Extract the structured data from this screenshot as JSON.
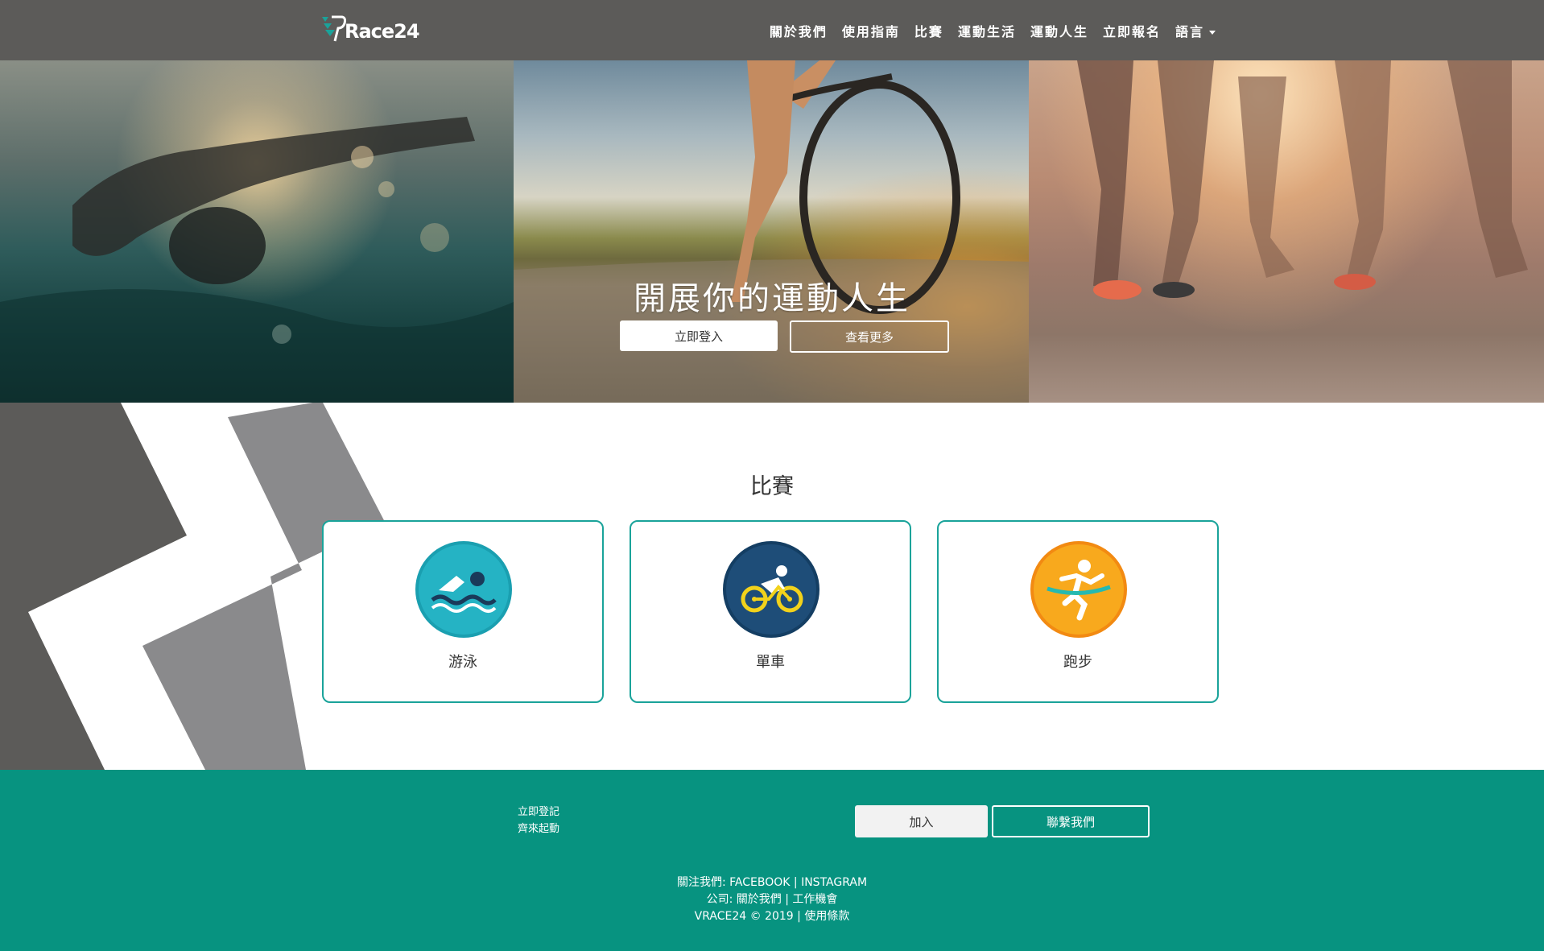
{
  "brand": {
    "logo_text": "Race24"
  },
  "nav": {
    "items": [
      "關於我們",
      "使用指南",
      "比賽",
      "運動生活",
      "運動人生",
      "立即報名"
    ],
    "language": "語言"
  },
  "hero": {
    "title": "開展你的運動人生",
    "login_button": "立即登入",
    "more_button": "查看更多"
  },
  "section": {
    "title": "比賽"
  },
  "cards": [
    {
      "label": "游泳",
      "icon": "swimming-icon",
      "color": "#1aa3b4"
    },
    {
      "label": "單車",
      "icon": "cycling-icon",
      "color": "#1e4d78"
    },
    {
      "label": "跑步",
      "icon": "running-icon",
      "color": "#f7a31c"
    }
  ],
  "footer": {
    "cta_line1": "立即登記",
    "cta_line2": "齊來起動",
    "join_button": "加入",
    "contact_button": "聯繫我們",
    "follow_label": "關注我們:",
    "facebook": "FACEBOOK",
    "instagram": "INSTAGRAM",
    "company_label": "公司:",
    "about": "關於我們",
    "careers": "工作機會",
    "copyright": "VRACE24 © 2019",
    "terms": "使用條款",
    "separator": "|"
  },
  "colors": {
    "navbar": "#5c5b59",
    "accent": "#1aa39a",
    "footer": "#079380"
  }
}
